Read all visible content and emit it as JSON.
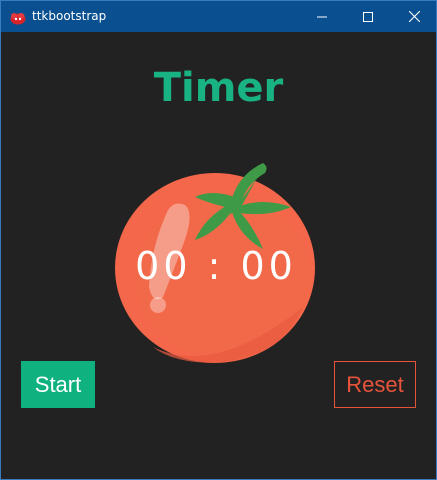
{
  "window": {
    "title": "ttkbootstrap",
    "icon": "ttkbootstrap-logo-icon"
  },
  "controls": {
    "minimize_icon": "minimize-icon",
    "maximize_icon": "maximize-icon",
    "close_icon": "close-icon"
  },
  "main": {
    "heading": "Timer",
    "time": "00 : 00",
    "timer_icon": "tomato-icon"
  },
  "buttons": {
    "start_label": "Start",
    "reset_label": "Reset"
  },
  "colors": {
    "background": "#222222",
    "titlebar": "#0a4f8f",
    "heading": "#19b383",
    "start_button": "#0fb27f",
    "reset_outline": "#e8533c",
    "tomato_body": "#f4674a",
    "tomato_leaves": "#3f9a47"
  }
}
